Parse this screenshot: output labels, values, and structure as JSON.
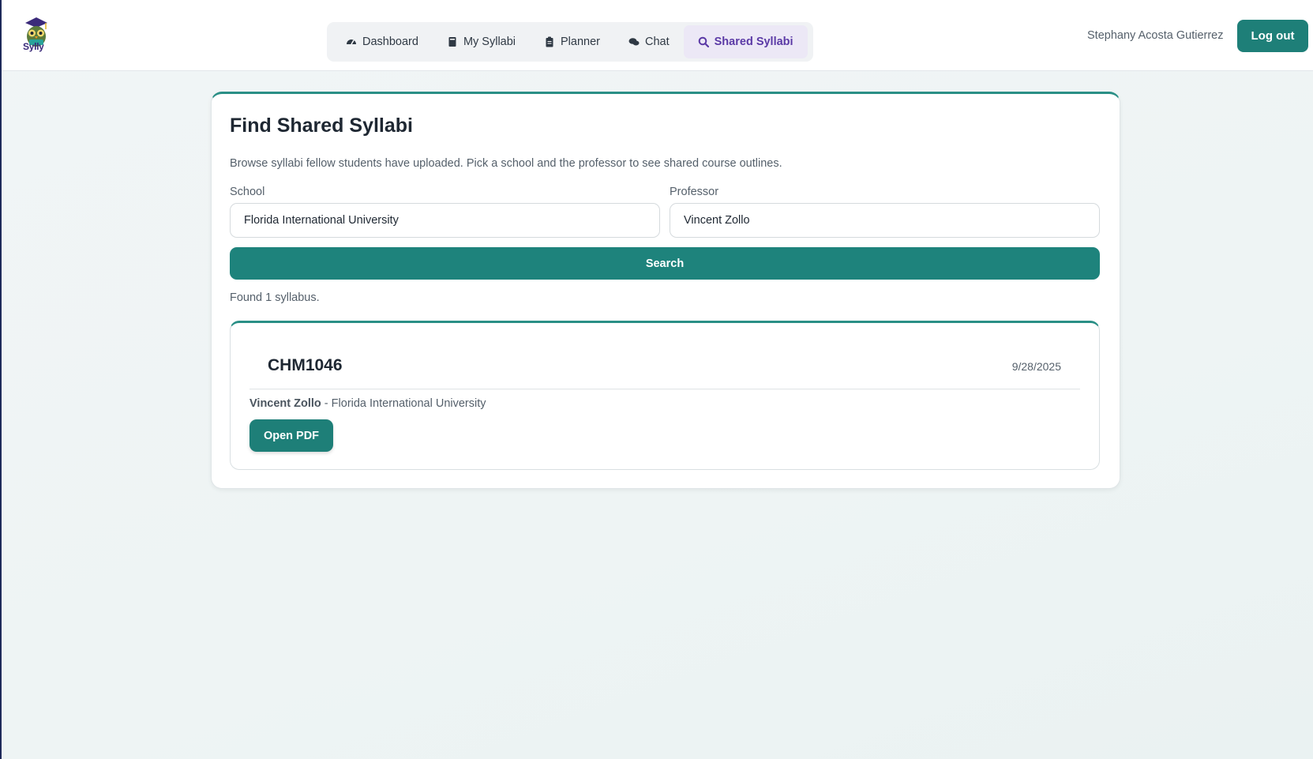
{
  "app": {
    "logo_text": "Sylly",
    "colors": {
      "accent": "#1e7f78",
      "nav_active": "#5b3aa6",
      "nav_active_bg": "#ece8f6"
    }
  },
  "nav": {
    "items": [
      {
        "label": "Dashboard",
        "icon": "gauge-icon",
        "active": false
      },
      {
        "label": "My Syllabi",
        "icon": "book-icon",
        "active": false
      },
      {
        "label": "Planner",
        "icon": "clipboard-icon",
        "active": false
      },
      {
        "label": "Chat",
        "icon": "chat-icon",
        "active": false
      },
      {
        "label": "Shared Syllabi",
        "icon": "search-icon",
        "active": true
      }
    ]
  },
  "user": {
    "name": "Stephany Acosta Gutierrez",
    "logout_label": "Log out"
  },
  "page": {
    "title": "Find Shared Syllabi",
    "description": "Browse syllabi fellow students have uploaded. Pick a school and the professor to see shared course outlines.",
    "school_label": "School",
    "school_value": "Florida International University",
    "professor_label": "Professor",
    "professor_value": "Vincent Zollo",
    "search_label": "Search",
    "found_text": "Found 1 syllabus."
  },
  "results": [
    {
      "course": "CHM1046",
      "date": "9/28/2025",
      "professor": "Vincent Zollo",
      "separator": " - ",
      "school": "Florida International University",
      "open_label": "Open PDF"
    }
  ]
}
